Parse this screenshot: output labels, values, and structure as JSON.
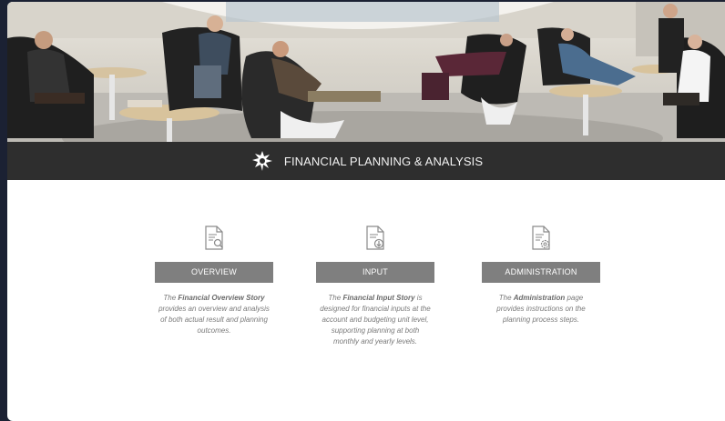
{
  "header": {
    "title": "FINANCIAL PLANNING & ANALYSIS",
    "logo_icon": "university-torch-logo-icon"
  },
  "cards": [
    {
      "icon": "document-search-icon",
      "button_label": "OVERVIEW",
      "desc_prefix": "The ",
      "desc_bold": "Financial Overview Story",
      "desc_suffix": " provides an overview and analysis of both actual result and planning outcomes."
    },
    {
      "icon": "document-download-icon",
      "button_label": "INPUT",
      "desc_prefix": "The ",
      "desc_bold": "Financial Input Story",
      "desc_suffix": " is designed for financial inputs at the account and budgeting unit level, supporting planning at both monthly and yearly levels."
    },
    {
      "icon": "document-settings-icon",
      "button_label": "ADMINISTRATION",
      "desc_prefix": "The ",
      "desc_bold": "Administration",
      "desc_suffix": " page provides instructions on the planning process steps."
    }
  ],
  "colors": {
    "page_background": "#1b2133",
    "titlebar": "#2e2e2e",
    "button": "#7f7f7f",
    "description_text": "#7a7a7a"
  }
}
